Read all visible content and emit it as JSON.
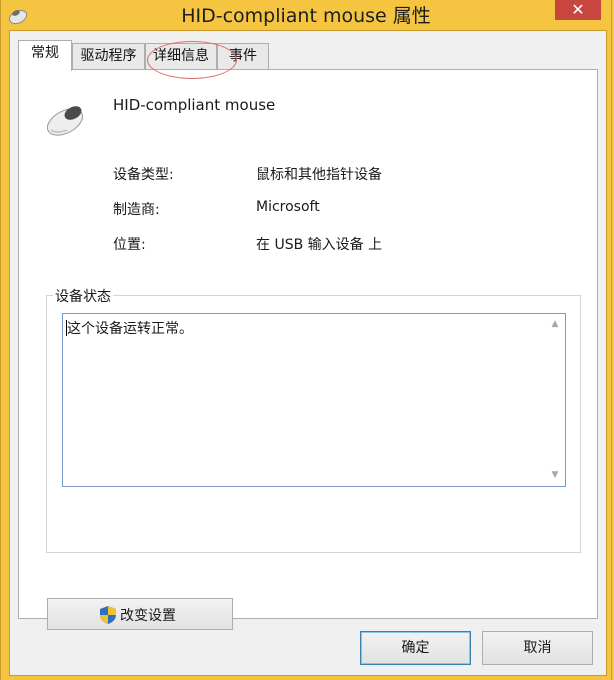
{
  "window": {
    "title": "HID-compliant mouse 属性",
    "close_glyph": "✕",
    "icon": "mouse-icon"
  },
  "tabs": [
    {
      "label": "常规",
      "active": true
    },
    {
      "label": "驱动程序",
      "active": false
    },
    {
      "label": "详细信息",
      "active": false
    },
    {
      "label": "事件",
      "active": false
    }
  ],
  "device": {
    "name": "HID-compliant mouse",
    "icon": "mouse-icon",
    "properties": [
      {
        "label": "设备类型:",
        "value": "鼠标和其他指针设备"
      },
      {
        "label": "制造商:",
        "value": "Microsoft"
      },
      {
        "label": "位置:",
        "value": "在 USB 输入设备 上"
      }
    ]
  },
  "status": {
    "group_title": "设备状态",
    "text": "这个设备运转正常。"
  },
  "change_settings": {
    "label": "改变设置",
    "icon": "uac-shield-icon"
  },
  "buttons": {
    "ok": "确定",
    "cancel": "取消"
  },
  "colors": {
    "title_bar": "#f5c542",
    "close_button": "#c7463d",
    "annotation_circle": "#e06a6a",
    "default_button_border": "#3c7fb1"
  }
}
